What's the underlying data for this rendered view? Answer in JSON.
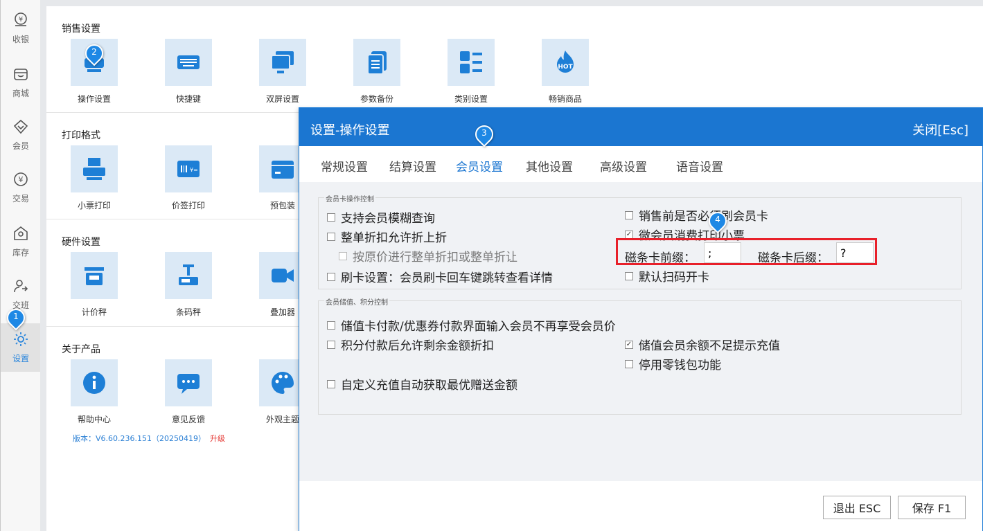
{
  "nav": {
    "items": [
      {
        "label": "收银",
        "icon": "cashier-icon"
      },
      {
        "label": "商城",
        "icon": "shop-icon"
      },
      {
        "label": "会员",
        "icon": "member-icon"
      },
      {
        "label": "交易",
        "icon": "yen-icon"
      },
      {
        "label": "库存",
        "icon": "inventory-icon"
      },
      {
        "label": "交班",
        "icon": "shift-icon"
      },
      {
        "label": "设置",
        "icon": "gear-icon"
      }
    ]
  },
  "sections": [
    {
      "title": "销售设置",
      "tiles": [
        "操作设置",
        "快捷键",
        "双屏设置",
        "参数备份",
        "类别设置",
        "畅销商品"
      ]
    },
    {
      "title": "打印格式",
      "tiles": [
        "小票打印",
        "价签打印",
        "预包装"
      ]
    },
    {
      "title": "硬件设置",
      "tiles": [
        "计价秤",
        "条码秤",
        "叠加器"
      ]
    },
    {
      "title": "关于产品",
      "tiles": [
        "帮助中心",
        "意见反馈",
        "外观主题"
      ]
    }
  ],
  "hot_badge": "HOT",
  "version": {
    "text": "版本：V6.60.236.151（20250419）",
    "upgrade": "升级"
  },
  "markers": [
    "1",
    "2",
    "3",
    "4"
  ],
  "dialog": {
    "title": "设置-操作设置",
    "close": "关闭[Esc]",
    "tabs": [
      "常规设置",
      "结算设置",
      "会员设置",
      "其他设置",
      "高级设置",
      "语音设置"
    ],
    "active_tab": "会员设置",
    "group1": {
      "title": "会员卡操作控制",
      "left": [
        {
          "label": "支持会员模糊查询",
          "checked": false
        },
        {
          "label": "整单折扣允许折上折",
          "checked": false
        },
        {
          "label": "按原价进行整单折扣或整单折让",
          "checked": false
        },
        {
          "label": "刷卡设置：会员刷卡回车键跳转查看详情",
          "checked": false
        }
      ],
      "right": [
        {
          "label": "销售前是否必须刷会员卡",
          "checked": false
        },
        {
          "label": "微会员消费打印小票",
          "checked": true
        },
        {
          "label": "默认扫码开卡",
          "checked": false
        }
      ],
      "prefix_label": "磁条卡前缀：",
      "prefix_value": ";",
      "suffix_label": "磁条卡后缀：",
      "suffix_value": "?"
    },
    "group2": {
      "title": "会员储值、积分控制",
      "left": [
        {
          "label": "储值卡付款/优惠券付款界面输入会员不再享受会员价",
          "checked": false
        },
        {
          "label": "积分付款后允许剩余金额折扣",
          "checked": false
        },
        {
          "label": "自定义充值自动获取最优赠送金额",
          "checked": false
        }
      ],
      "right": [
        {
          "label": "储值会员余额不足提示充值",
          "checked": true
        },
        {
          "label": "停用零钱包功能",
          "checked": false
        }
      ]
    },
    "buttons": {
      "exit": "退出 ESC",
      "save": "保存 F1"
    }
  },
  "colors": {
    "primary": "#1b76d1",
    "tile_bg": "#dbe9f6",
    "icon_blue": "#1e7fd6",
    "highlight": "#e8202a"
  }
}
